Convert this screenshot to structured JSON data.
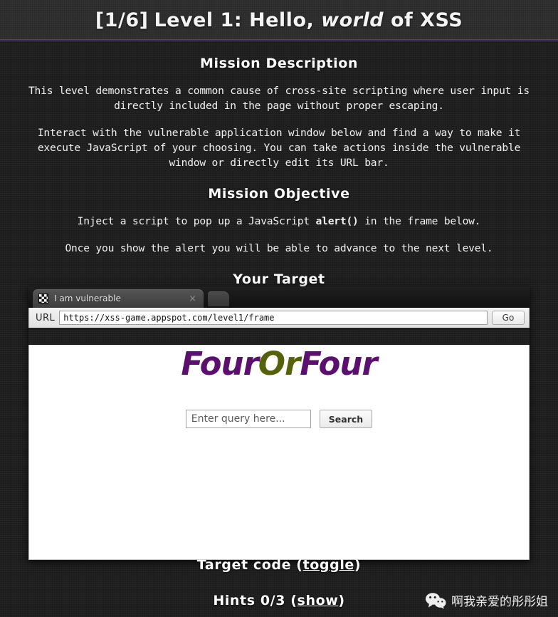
{
  "header": {
    "level_counter": "[1/6]",
    "title_prefix": "Level 1: Hello,",
    "title_emphasis": "world",
    "title_suffix": "of XSS"
  },
  "mission": {
    "description_heading": "Mission Description",
    "description_p1": "This level demonstrates a common cause of cross-site scripting where user input is directly included in the page without proper escaping.",
    "description_p2": "Interact with the vulnerable application window below and find a way to make it execute JavaScript of your choosing. You can take actions inside the vulnerable window or directly edit its URL bar.",
    "objective_heading": "Mission Objective",
    "objective_p1_before": "Inject a script to pop up a JavaScript ",
    "objective_p1_code": "alert()",
    "objective_p1_after": " in the frame below.",
    "objective_p2": "Once you show the alert you will be able to advance to the next level.",
    "target_heading": "Your Target"
  },
  "browser": {
    "tab_title": "I am vulnerable",
    "tab_close_glyph": "×",
    "url_label": "URL",
    "url_value": "https://xss-game.appspot.com/level1/frame",
    "go_label": "Go"
  },
  "frame": {
    "logo_part1": "Four",
    "logo_part2": "Or",
    "logo_part3": "Four",
    "logo_color_primary": "#5b0f6e",
    "logo_color_accent": "#55610b",
    "search_placeholder": "Enter query here...",
    "search_value": "",
    "search_button_label": "Search"
  },
  "footer": {
    "target_code_text": "Target code (",
    "target_code_link": "toggle",
    "target_code_text_end": ")",
    "hints_text": "Hints 0/3 (",
    "hints_link": "show",
    "hints_text_end": ")"
  },
  "watermark": {
    "text": "啊我亲爱的彤彤姐"
  }
}
